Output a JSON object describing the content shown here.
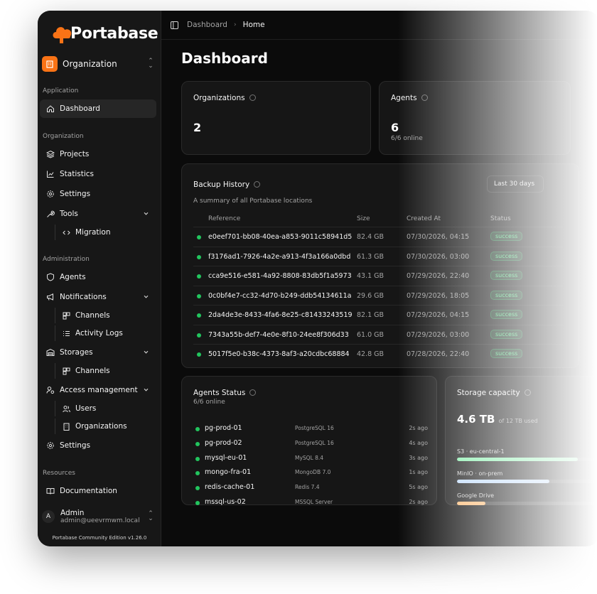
{
  "brand": {
    "name": "Portabase",
    "accent": "#f97316"
  },
  "org_switcher": {
    "label": "Organization"
  },
  "sidebar": {
    "sections": {
      "application": "Application",
      "organization": "Organization",
      "administration": "Administration",
      "resources": "Resources"
    },
    "items": {
      "dashboard": "Dashboard",
      "projects": "Projects",
      "statistics": "Statistics",
      "settings": "Settings",
      "tools": "Tools",
      "migration": "Migration",
      "agents": "Agents",
      "notifications": "Notifications",
      "notif_channels": "Channels",
      "activity_logs": "Activity Logs",
      "storages": "Storages",
      "storage_channels": "Channels",
      "access_management": "Access management",
      "users": "Users",
      "organizations": "Organizations",
      "admin_settings": "Settings",
      "documentation": "Documentation"
    }
  },
  "user": {
    "initial": "A",
    "name": "Admin",
    "email": "admin@ueevrmwm.local"
  },
  "edition": "Portabase Community Edition v1.26.0",
  "breadcrumb": {
    "parent": "Dashboard",
    "current": "Home"
  },
  "page_title": "Dashboard",
  "stats": {
    "organizations": {
      "label": "Organizations",
      "value": "2"
    },
    "agents": {
      "label": "Agents",
      "value": "6",
      "sub": "6/6 online"
    }
  },
  "backup_history": {
    "title": "Backup History",
    "subtitle": "A summary of all Portabase locations",
    "range": "Last 30 days",
    "columns": {
      "reference": "Reference",
      "size": "Size",
      "created": "Created At",
      "status": "Status"
    },
    "rows": [
      {
        "ref": "e0eef701-bb08-40ea-a853-9011c58941d5",
        "size": "82.4 GB",
        "created": "07/30/2026, 04:15",
        "status": "success"
      },
      {
        "ref": "f3176ad1-7926-4a2e-a913-4f3a166a0dbd",
        "size": "61.3 GB",
        "created": "07/30/2026, 03:00",
        "status": "success"
      },
      {
        "ref": "cca9e516-e581-4a92-8808-83db5f1a5973",
        "size": "43.1 GB",
        "created": "07/29/2026, 22:40",
        "status": "success"
      },
      {
        "ref": "0c0bf4e7-cc32-4d70-b249-ddb54134611a",
        "size": "29.6 GB",
        "created": "07/29/2026, 18:05",
        "status": "success"
      },
      {
        "ref": "2da4de3e-8433-4fa6-8e25-c81433243519",
        "size": "82.1 GB",
        "created": "07/29/2026, 04:15",
        "status": "success"
      },
      {
        "ref": "7343a55b-def7-4e0e-8f10-24ee8f306d33",
        "size": "61.0 GB",
        "created": "07/29/2026, 03:00",
        "status": "success"
      },
      {
        "ref": "5017f5e0-b38c-4373-8af3-a20cdbc68884",
        "size": "42.8 GB",
        "created": "07/28/2026, 22:40",
        "status": "success"
      }
    ]
  },
  "agents_status": {
    "title": "Agents Status",
    "subtitle": "6/6 online",
    "rows": [
      {
        "name": "pg-prod-01",
        "db": "PostgreSQL 16",
        "time": "2s ago"
      },
      {
        "name": "pg-prod-02",
        "db": "PostgreSQL 16",
        "time": "4s ago"
      },
      {
        "name": "mysql-eu-01",
        "db": "MySQL 8.4",
        "time": "3s ago"
      },
      {
        "name": "mongo-fra-01",
        "db": "MongoDB 7.0",
        "time": "1s ago"
      },
      {
        "name": "redis-cache-01",
        "db": "Redis 7.4",
        "time": "5s ago"
      },
      {
        "name": "mssql-us-02",
        "db": "MSSQL Server",
        "time": "2s ago"
      }
    ]
  },
  "storage": {
    "title": "Storage capacity",
    "used": "4.6 TB",
    "total": "of 12 TB used",
    "items": [
      {
        "name": "S3 · eu-central-1",
        "fill": 0.85,
        "color": "#86efac"
      },
      {
        "name": "MinIO · on-prem",
        "fill": 0.65,
        "color": "#bfdbfe"
      },
      {
        "name": "Google Drive",
        "fill": 0.2,
        "color": "#fdba74"
      }
    ]
  },
  "colors": {
    "success": "#22c55e",
    "bg": "#0b0b0b",
    "sidebar": "#171717"
  }
}
